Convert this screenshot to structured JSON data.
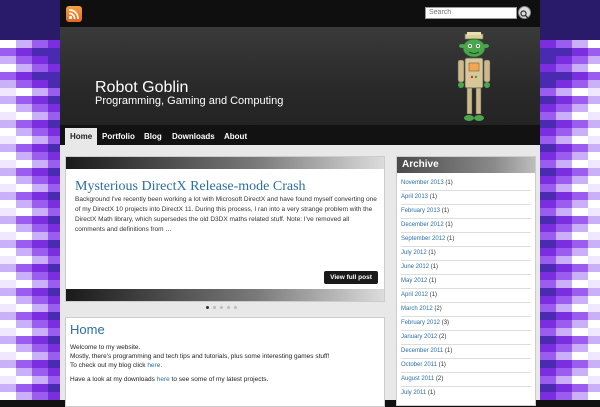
{
  "search": {
    "placeholder": "Search"
  },
  "header": {
    "title": "Robot Goblin",
    "tagline": "Programming, Gaming and Computing"
  },
  "nav": {
    "items": [
      {
        "label": "Home"
      },
      {
        "label": "Portfolio"
      },
      {
        "label": "Blog"
      },
      {
        "label": "Downloads"
      },
      {
        "label": "About"
      }
    ]
  },
  "slider": {
    "post_title": "Mysterious DirectX Release-mode Crash",
    "excerpt": "Background I've recently been working a lot with Microsoft DirectX and have found myself converting one of my DirectX 10 projects into DirectX 11. During this process, I ran into a very strange problem with the DirectX Math library, which supersedes the old D3DX maths related stuff. Note: I've removed all comments and definitions from …",
    "button": "View full post",
    "slide_count": 5,
    "active_slide": 1
  },
  "home": {
    "title": "Home",
    "line1": "Welcome to my website.",
    "line2": "Mostly, there's programming and tech tips and tutorials, plus some interesting games stuff!",
    "line3_text": "To check out my blog click ",
    "line3_link": "here",
    "line3_end": ".",
    "line4_text": "Have a look at my downloads ",
    "line4_link": "here",
    "line4_end": " to see some of my latest projects."
  },
  "sidebar": {
    "title": "Archive",
    "items": [
      {
        "month": "November 2013",
        "count": "(1)"
      },
      {
        "month": "April 2013",
        "count": "(1)"
      },
      {
        "month": "February 2013",
        "count": "(1)"
      },
      {
        "month": "December 2012",
        "count": "(1)"
      },
      {
        "month": "September 2012",
        "count": "(1)"
      },
      {
        "month": "July 2012",
        "count": "(1)"
      },
      {
        "month": "June 2012",
        "count": "(1)"
      },
      {
        "month": "May 2012",
        "count": "(1)"
      },
      {
        "month": "April 2012",
        "count": "(1)"
      },
      {
        "month": "March 2012",
        "count": "(2)"
      },
      {
        "month": "February 2012",
        "count": "(3)"
      },
      {
        "month": "January 2012",
        "count": "(2)"
      },
      {
        "month": "December 2011",
        "count": "(1)"
      },
      {
        "month": "October 2011",
        "count": "(1)"
      },
      {
        "month": "August 2011",
        "count": "(2)"
      },
      {
        "month": "July 2011",
        "count": "(1)"
      }
    ]
  },
  "colors": {
    "accent": "#2a6fa8",
    "mosaic_purple": "#7a2ee0"
  }
}
